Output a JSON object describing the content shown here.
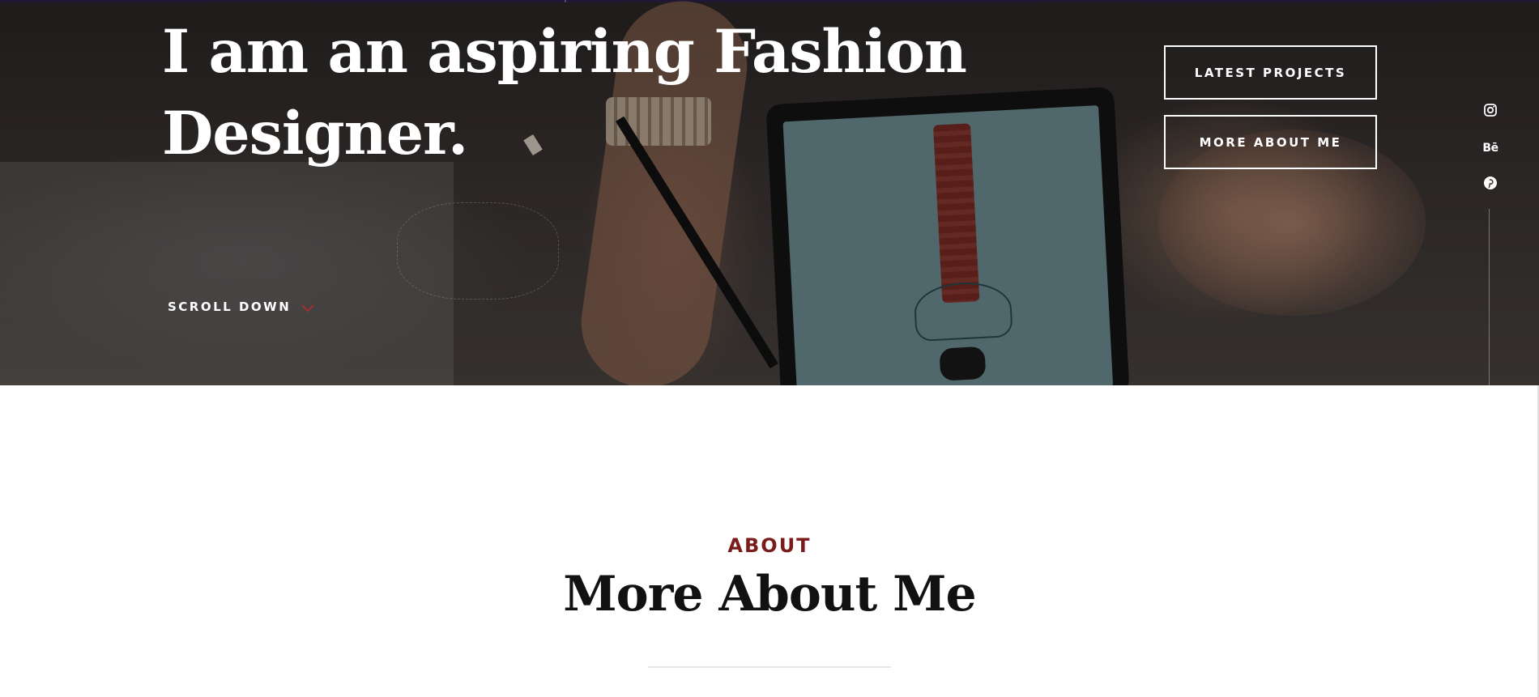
{
  "hero": {
    "title": "I am an aspiring Fashion Designer.",
    "buttons": {
      "latest_projects": "LATEST PROJECTS",
      "more_about_me": "MORE ABOUT ME"
    },
    "scroll_label": "SCROLL DOWN",
    "social": [
      {
        "icon": "instagram-icon"
      },
      {
        "icon": "behance-icon",
        "glyph": "Bē"
      },
      {
        "icon": "pinterest-icon"
      }
    ]
  },
  "about": {
    "eyebrow": "ABOUT",
    "title": "More About Me"
  },
  "colors": {
    "accent": "#7a1c1c",
    "text_dark": "#111111",
    "hero_text": "#ffffff",
    "divider": "#e6e6e6"
  }
}
